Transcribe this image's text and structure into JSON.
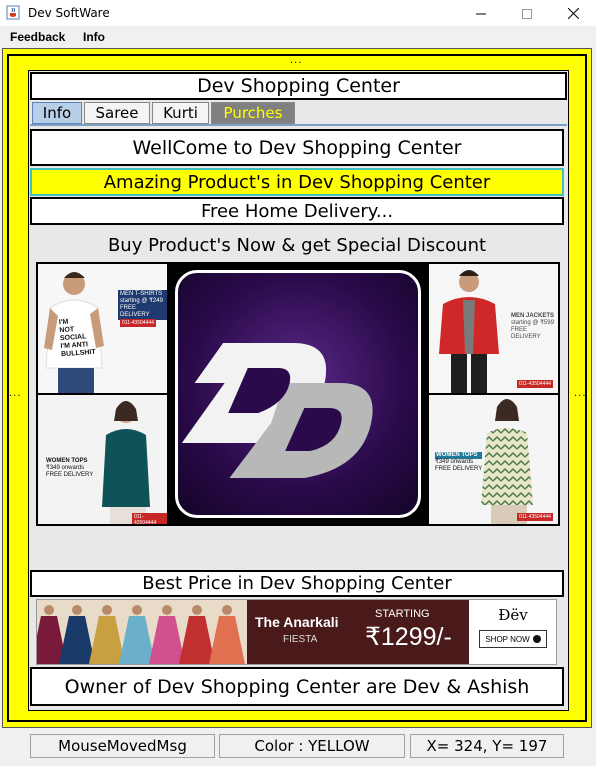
{
  "window": {
    "title": "Dev SoftWare",
    "icon": "java-cup-icon",
    "controls": [
      "minimize-icon",
      "maximize-icon",
      "close-icon"
    ]
  },
  "menu": {
    "items": [
      "Feedback",
      "Info"
    ]
  },
  "dots": "...",
  "header": {
    "title": "Dev Shopping Center"
  },
  "tabs": [
    {
      "label": "Info",
      "selected": true
    },
    {
      "label": "Saree",
      "selected": false
    },
    {
      "label": "Kurti",
      "selected": false
    },
    {
      "label": "Purches",
      "selected": false
    }
  ],
  "content": {
    "welcome": "WellCome to Dev Shopping Center",
    "amazing": "Amazing Product's in Dev Shopping Center",
    "delivery": "Free Home Delivery...",
    "discount": "Buy Product's Now & get Special Discount",
    "best_price": "Best Price in Dev Shopping Center",
    "owner": "Owner of Dev Shopping Center are Dev & Ashish"
  },
  "gallery": {
    "logo_icon": "dd-logo-icon",
    "tiles": [
      {
        "badge": [
          "MEN T-SHIRTS",
          "starting @ ₹249",
          "FREE DELIVERY"
        ],
        "phone": "011-43504444",
        "shirt_text": [
          "I'M",
          "NOT",
          "SOCIAL",
          "I'M ANTI",
          "BULLSHIT"
        ]
      },
      {
        "badge": [
          "MEN JACKETS",
          "starting @ ₹599",
          "FREE DELIVERY"
        ],
        "phone": "011-43504444"
      },
      {
        "badge": [
          "WOMEN TOPS",
          "₹349 onwards",
          "FREE DELIVERY"
        ],
        "phone": "011-43504444"
      },
      {
        "badge": [
          "WOMEN TOPS",
          "₹349 onwards",
          "FREE DELIVERY"
        ],
        "phone": "011-43504444"
      }
    ]
  },
  "ad_banner": {
    "name": "The Anarkali",
    "sub": "FIESTA",
    "starting": "STARTING",
    "price": "₹1299/-",
    "brand": "Đëv",
    "cta": "SHOP NOW"
  },
  "status": {
    "message": "MouseMovedMsg",
    "color": "Color : YELLOW",
    "coords": "X= 324, Y= 197"
  },
  "colors": {
    "frame": "#ffff00",
    "tab_selected": "#b8cfe8",
    "tab_purches": "#808080",
    "tab_purches_text": "#ffff00",
    "amazing_bg": "#ffff00",
    "amazing_border": "#40c0c0",
    "logo_bg": "#2a0a4a"
  }
}
